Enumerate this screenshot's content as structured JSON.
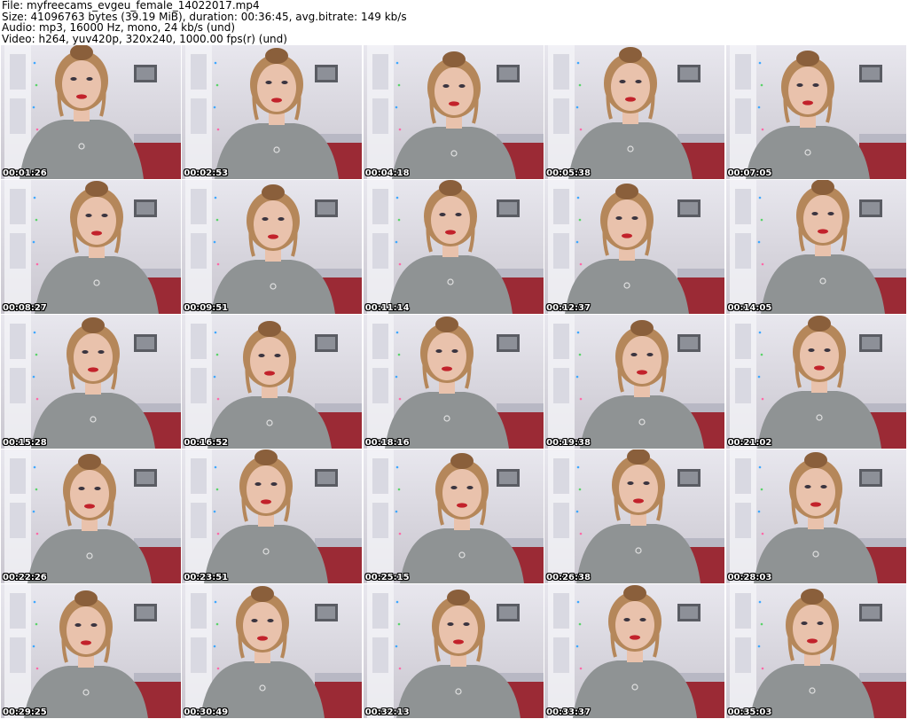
{
  "header": {
    "file_line": "File: myfreecams_evgeu_female_14022017.mp4",
    "size_line": "Size: 41096763 bytes (39.19 MiB), duration: 00:36:45, avg.bitrate: 149 kb/s",
    "audio_line": "Audio: mp3, 16000 Hz, mono, 24 kb/s (und)",
    "video_line": "Video: h264, yuv420p, 320x240, 1000.00 fps(r) (und)"
  },
  "thumbnails": [
    {
      "timestamp": "00:01:26"
    },
    {
      "timestamp": "00:02:53"
    },
    {
      "timestamp": "00:04:18"
    },
    {
      "timestamp": "00:05:38"
    },
    {
      "timestamp": "00:07:05"
    },
    {
      "timestamp": "00:08:27"
    },
    {
      "timestamp": "00:09:51"
    },
    {
      "timestamp": "00:11:14"
    },
    {
      "timestamp": "00:12:37"
    },
    {
      "timestamp": "00:14:05"
    },
    {
      "timestamp": "00:15:28"
    },
    {
      "timestamp": "00:16:52"
    },
    {
      "timestamp": "00:18:16"
    },
    {
      "timestamp": "00:19:38"
    },
    {
      "timestamp": "00:21:02"
    },
    {
      "timestamp": "00:22:26"
    },
    {
      "timestamp": "00:23:51"
    },
    {
      "timestamp": "00:25:15"
    },
    {
      "timestamp": "00:26:38"
    },
    {
      "timestamp": "00:28:03"
    },
    {
      "timestamp": "00:29:25"
    },
    {
      "timestamp": "00:30:49"
    },
    {
      "timestamp": "00:32:13"
    },
    {
      "timestamp": "00:33:37"
    },
    {
      "timestamp": "00:35:03"
    }
  ],
  "colors": {
    "wall": "#c9c6cf",
    "sweater": "#8f9394",
    "hair": "#b5875a",
    "skin": "#e9c2ac",
    "lips": "#c2222b",
    "bed": "#9b2a35"
  }
}
